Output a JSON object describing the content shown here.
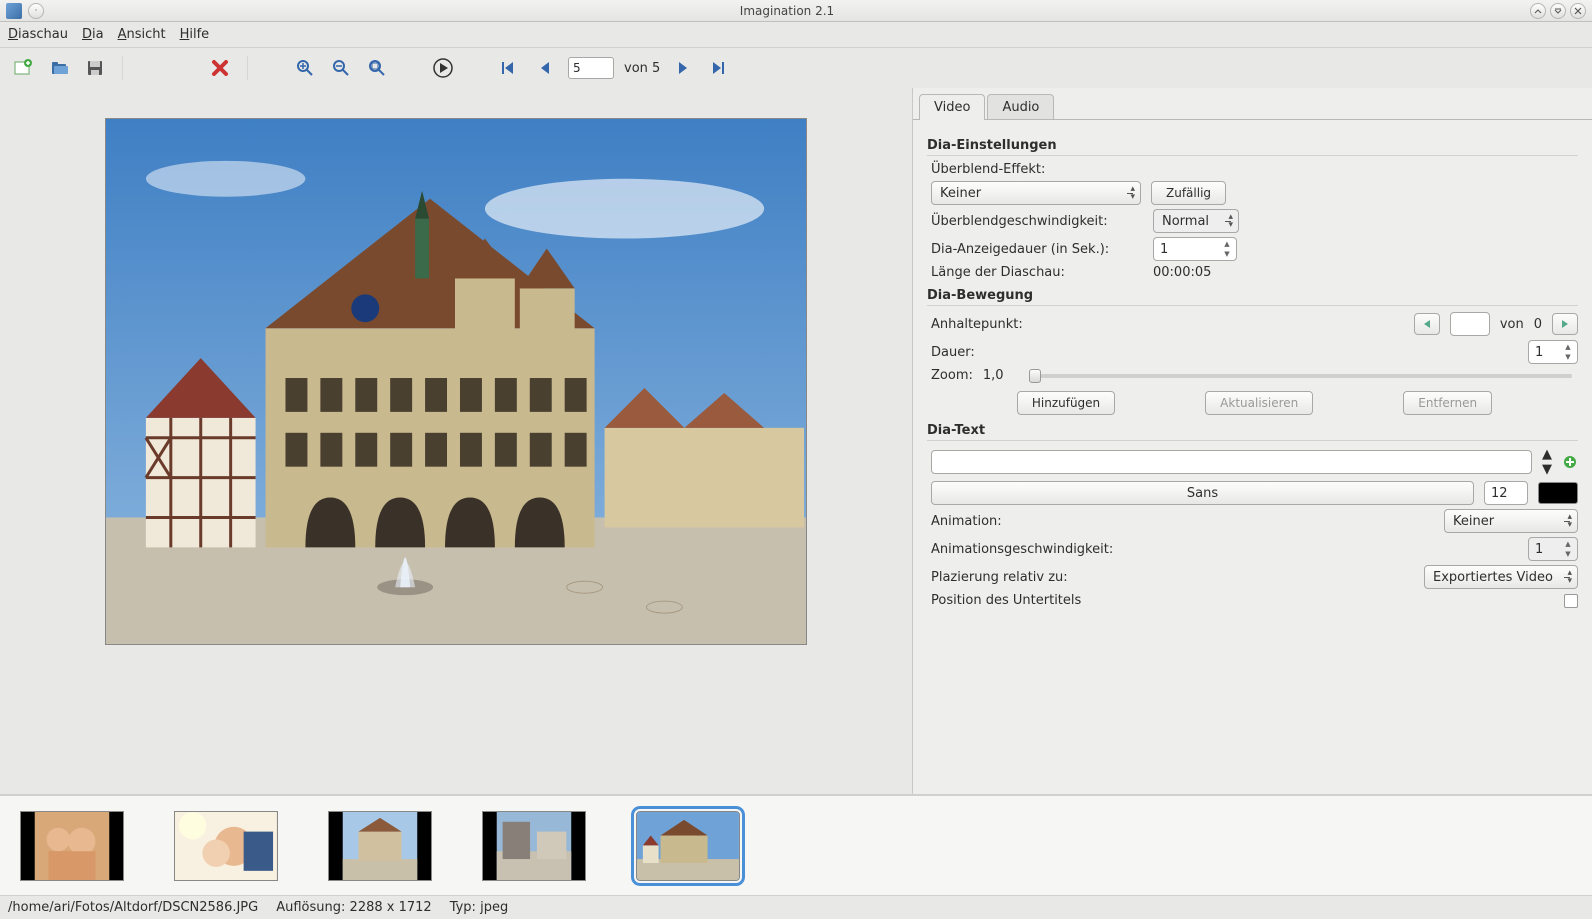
{
  "window": {
    "title": "Imagination 2.1"
  },
  "menu": {
    "diaschau": "Diaschau",
    "dia": "Dia",
    "ansicht": "Ansicht",
    "hilfe": "Hilfe"
  },
  "toolbar": {
    "slide_current": "5",
    "slide_of_label": "von 5"
  },
  "tabs": {
    "video": "Video",
    "audio": "Audio"
  },
  "settings": {
    "section_title": "Dia-Einstellungen",
    "effect_label": "Überblend-Effekt:",
    "effect_value": "Keiner",
    "random_btn": "Zufällig",
    "speed_label": "Überblendgeschwindigkeit:",
    "speed_value": "Normal",
    "duration_label": "Dia-Anzeigedauer (in Sek.):",
    "duration_value": "1",
    "length_label": "Länge der Diaschau:",
    "length_value": "00:00:05"
  },
  "movement": {
    "section_title": "Dia-Bewegung",
    "stop_label": "Anhaltepunkt:",
    "stop_field": "",
    "stop_of_label": "von",
    "stop_total": "0",
    "duration_label": "Dauer:",
    "duration_value": "1",
    "zoom_label": "Zoom:",
    "zoom_value": "1,0",
    "add_btn": "Hinzufügen",
    "update_btn": "Aktualisieren",
    "remove_btn": "Entfernen"
  },
  "text": {
    "section_title": "Dia-Text",
    "font_name": "Sans",
    "font_size": "12",
    "animation_label": "Animation:",
    "animation_value": "Keiner",
    "anim_speed_label": "Animationsgeschwindigkeit:",
    "anim_speed_value": "1",
    "placement_label": "Plazierung relativ zu:",
    "placement_value": "Exportiertes Video",
    "position_label": "Position des Untertitels"
  },
  "status": {
    "path": "/home/ari/Fotos/Altdorf/DSCN2586.JPG",
    "resolution_label": "Auflösung:",
    "resolution_value": "2288 x 1712",
    "type_label": "Typ:",
    "type_value": "jpeg"
  }
}
